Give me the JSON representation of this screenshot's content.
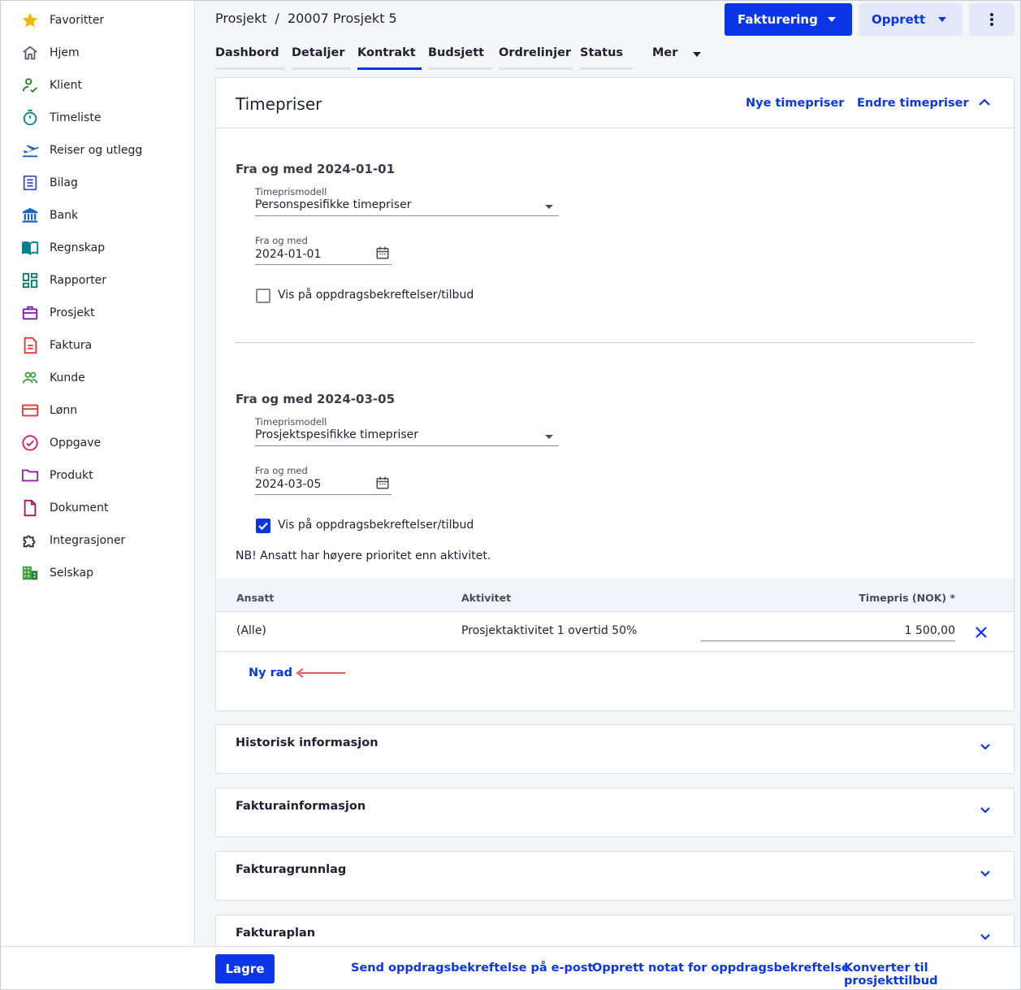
{
  "sidebar": {
    "items": [
      {
        "label": "Favoritter",
        "icon": "star-icon",
        "color": "#f5b400"
      },
      {
        "label": "Hjem",
        "icon": "home-icon",
        "color": "#5a6070"
      },
      {
        "label": "Klient",
        "icon": "client-check-icon",
        "color": "#2e7d32"
      },
      {
        "label": "Timeliste",
        "icon": "stopwatch-icon",
        "color": "#00897b"
      },
      {
        "label": "Reiser og utlegg",
        "icon": "airplane-icon",
        "color": "#1565c0"
      },
      {
        "label": "Bilag",
        "icon": "receipt-icon",
        "color": "#3f51b5"
      },
      {
        "label": "Bank",
        "icon": "bank-icon",
        "color": "#1565c0"
      },
      {
        "label": "Regnskap",
        "icon": "book-icon",
        "color": "#00838f"
      },
      {
        "label": "Rapporter",
        "icon": "dashboard-icon",
        "color": "#00796b"
      },
      {
        "label": "Prosjekt",
        "icon": "briefcase-icon",
        "color": "#7b1fa2"
      },
      {
        "label": "Faktura",
        "icon": "invoice-icon",
        "color": "#e53935"
      },
      {
        "label": "Kunde",
        "icon": "people-icon",
        "color": "#43a047"
      },
      {
        "label": "Lønn",
        "icon": "payment-card-icon",
        "color": "#e53935"
      },
      {
        "label": "Oppgave",
        "icon": "task-check-icon",
        "color": "#d81b60"
      },
      {
        "label": "Produkt",
        "icon": "folder-icon",
        "color": "#8e24aa"
      },
      {
        "label": "Dokument",
        "icon": "document-icon",
        "color": "#ad1457"
      },
      {
        "label": "Integrasjoner",
        "icon": "puzzle-icon",
        "color": "#263238"
      },
      {
        "label": "Selskap",
        "icon": "building-icon",
        "color": "#43a047"
      }
    ]
  },
  "breadcrumb": {
    "parent": "Prosjekt",
    "separator": "/",
    "current": "20007 Prosjekt 5"
  },
  "header_buttons": {
    "fakturering": "Fakturering",
    "opprett": "Opprett"
  },
  "tabs": [
    {
      "label": "Dashbord",
      "active": false
    },
    {
      "label": "Detaljer",
      "active": false
    },
    {
      "label": "Kontrakt",
      "active": true
    },
    {
      "label": "Budsjett",
      "active": false
    },
    {
      "label": "Ordrelinjer",
      "active": false
    },
    {
      "label": "Status",
      "active": false
    },
    {
      "label": "Mer",
      "active": false
    }
  ],
  "timepriser": {
    "title": "Timepriser",
    "new_link": "Nye timepriser",
    "edit_link": "Endre timepriser",
    "blocks": [
      {
        "heading": "Fra og med 2024-01-01",
        "model_label": "Timeprismodell",
        "model_value": "Personspesifikke timepriser",
        "date_label": "Fra og med",
        "date_value": "2024-01-01",
        "checkbox_label": "Vis på oppdragsbekreftelser/tilbud",
        "checked": false
      },
      {
        "heading": "Fra og med 2024-03-05",
        "model_label": "Timeprismodell",
        "model_value": "Prosjektspesifikke timepriser",
        "date_label": "Fra og med",
        "date_value": "2024-03-05",
        "checkbox_label": "Vis på oppdragsbekreftelser/tilbud",
        "checked": true
      }
    ],
    "note": "NB! Ansatt har høyere prioritet enn aktivitet.",
    "table": {
      "headers": {
        "employee": "Ansatt",
        "activity": "Aktivitet",
        "rate": "Timepris (NOK) *"
      },
      "rows": [
        {
          "employee": "(Alle)",
          "activity": "Prosjektaktivitet 1 overtid 50%",
          "rate": "1 500,00"
        }
      ]
    },
    "new_row": "Ny rad"
  },
  "collapsed_sections": [
    "Historisk informasjon",
    "Fakturainformasjon",
    "Fakturagrunnlag",
    "Fakturaplan"
  ],
  "footer": {
    "save": "Lagre",
    "send": "Send oppdragsbekreftelse på e-post",
    "note": "Opprett notat for oppdragsbekreftelse",
    "convert": "Konverter til prosjekttilbud"
  },
  "colors": {
    "accent": "#0b36e8",
    "annotation_arrow": "#e05a5a"
  }
}
